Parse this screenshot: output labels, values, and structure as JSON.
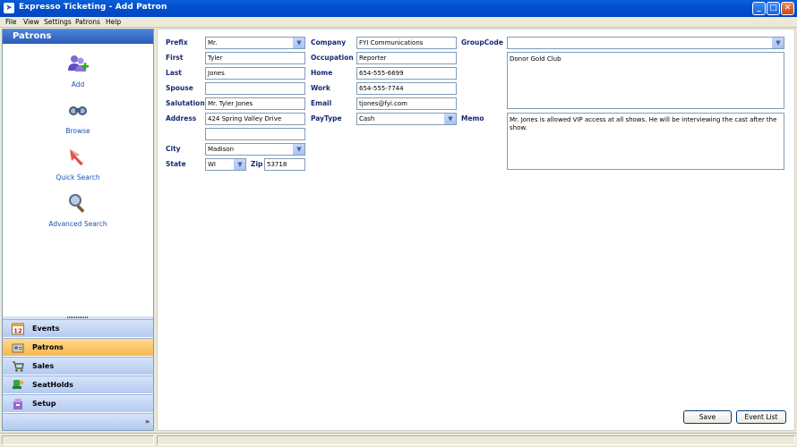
{
  "window": {
    "title": "Expresso Ticketing - Add Patron",
    "min": "_",
    "max": "□",
    "close": "✕"
  },
  "menu": [
    "File",
    "View",
    "Settings",
    "Patrons",
    "Help"
  ],
  "left_pane": {
    "header": "Patrons",
    "actions": [
      {
        "label": "Add",
        "icon": "add-user-icon"
      },
      {
        "label": "Browse",
        "icon": "binoculars-icon"
      },
      {
        "label": "Quick Search",
        "icon": "quick-search-icon"
      },
      {
        "label": "Advanced Search",
        "icon": "magnifier-icon"
      }
    ],
    "nav": [
      {
        "label": "Events",
        "icon": "calendar-icon",
        "active": false
      },
      {
        "label": "Patrons",
        "icon": "patrons-icon",
        "active": true
      },
      {
        "label": "Sales",
        "icon": "cart-icon",
        "active": false
      },
      {
        "label": "SeatHolds",
        "icon": "seat-holds-icon",
        "active": false
      },
      {
        "label": "Setup",
        "icon": "setup-icon",
        "active": false
      }
    ],
    "more": "»",
    "calendar_day": "12"
  },
  "form": {
    "prefix": {
      "label": "Prefix",
      "value": "Mr."
    },
    "first": {
      "label": "First",
      "value": "Tyler"
    },
    "last": {
      "label": "Last",
      "value": "Jones"
    },
    "spouse": {
      "label": "Spouse",
      "value": ""
    },
    "salutation": {
      "label": "Salutation",
      "value": "Mr. Tyler Jones"
    },
    "address": {
      "label": "Address",
      "value": "424 Spring Valley Drive",
      "value2": ""
    },
    "city": {
      "label": "City",
      "value": "Madison"
    },
    "state": {
      "label": "State",
      "value": "WI"
    },
    "zip": {
      "label": "Zip",
      "value": "53718"
    },
    "company": {
      "label": "Company",
      "value": "FYI Communications"
    },
    "occupation": {
      "label": "Occupation",
      "value": "Reporter"
    },
    "home": {
      "label": "Home",
      "value": "654-555-6699"
    },
    "work": {
      "label": "Work",
      "value": "654-555-7744"
    },
    "email": {
      "label": "Email",
      "value": "tjones@fyi.com"
    },
    "paytype": {
      "label": "PayType",
      "value": "Cash"
    },
    "groupcode": {
      "label": "GroupCode",
      "value": "",
      "list": "Donor Gold Club"
    },
    "memo": {
      "label": "Memo",
      "value": "Mr. Jones is allowed VIP access at all shows. He will be interviewing the cast after the show."
    }
  },
  "buttons": {
    "save": "Save",
    "event_list": "Event List"
  },
  "colors": {
    "label": "#152a74",
    "accent_active": "#f7b84a",
    "titlebar": "#0150d0"
  }
}
